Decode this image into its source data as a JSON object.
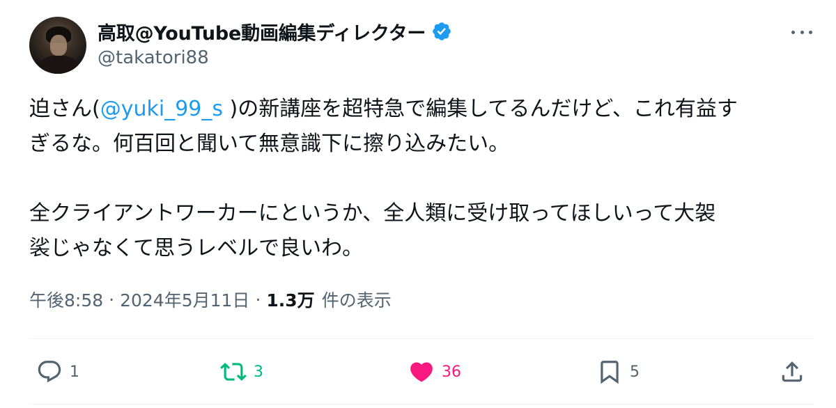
{
  "author": {
    "display_name": "高取@YouTube動画編集ディレクター",
    "handle": "@takatori88",
    "verified": true,
    "verified_color": "#1d9bf0"
  },
  "tweet": {
    "line1_before_mention": "迫さん(",
    "mention": "@yuki_99_s",
    "line1_after_mention": " )の新講座を超特急で編集してるんだけど、これ有益す",
    "line2": "ぎるな。何百回と聞いて無意識下に擦り込みたい。",
    "line3": "全クライアントワーカーにというか、全人類に受け取ってほしいって大袈",
    "line4": "裟じゃなくて思うレベルで良いわ。"
  },
  "meta": {
    "time": "午後8:58",
    "separator": "·",
    "date": "2024年5月11日",
    "views_count": "1.3万",
    "views_label": "件の表示"
  },
  "actions": {
    "reply_count": "1",
    "retweet_count": "3",
    "like_count": "36",
    "bookmark_count": "5"
  },
  "colors": {
    "text": "#0f1419",
    "secondary": "#536471",
    "link": "#1d9bf0",
    "retweet_green": "#00ba7c",
    "like_pink": "#f91880"
  },
  "icons": [
    "more-icon",
    "verified-badge-icon",
    "reply-icon",
    "retweet-icon",
    "like-heart-icon",
    "bookmark-icon",
    "share-icon"
  ]
}
